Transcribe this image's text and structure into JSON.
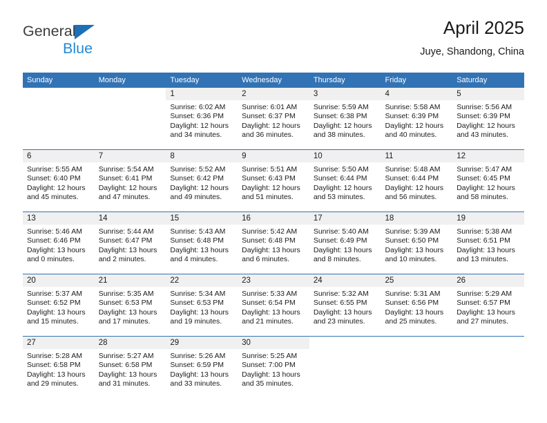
{
  "brand": {
    "name_top": "General",
    "name_bottom": "Blue",
    "accent_color": "#1e6fb8",
    "blue_text_color": "#2389d6"
  },
  "header": {
    "title": "April 2025",
    "subtitle": "Juye, Shandong, China"
  },
  "theme": {
    "header_blue": "#3273b5",
    "daynum_band": "#f0f0f0",
    "text": "#1a1a1a"
  },
  "weekday_headers": [
    "Sunday",
    "Monday",
    "Tuesday",
    "Wednesday",
    "Thursday",
    "Friday",
    "Saturday"
  ],
  "weeks": [
    [
      {
        "day": "",
        "sunrise": "",
        "sunset": "",
        "daylight_line1": "",
        "daylight_line2": "",
        "filled": false
      },
      {
        "day": "",
        "sunrise": "",
        "sunset": "",
        "daylight_line1": "",
        "daylight_line2": "",
        "filled": false
      },
      {
        "day": "1",
        "sunrise": "Sunrise: 6:02 AM",
        "sunset": "Sunset: 6:36 PM",
        "daylight_line1": "Daylight: 12 hours",
        "daylight_line2": "and 34 minutes.",
        "filled": true
      },
      {
        "day": "2",
        "sunrise": "Sunrise: 6:01 AM",
        "sunset": "Sunset: 6:37 PM",
        "daylight_line1": "Daylight: 12 hours",
        "daylight_line2": "and 36 minutes.",
        "filled": true
      },
      {
        "day": "3",
        "sunrise": "Sunrise: 5:59 AM",
        "sunset": "Sunset: 6:38 PM",
        "daylight_line1": "Daylight: 12 hours",
        "daylight_line2": "and 38 minutes.",
        "filled": true
      },
      {
        "day": "4",
        "sunrise": "Sunrise: 5:58 AM",
        "sunset": "Sunset: 6:39 PM",
        "daylight_line1": "Daylight: 12 hours",
        "daylight_line2": "and 40 minutes.",
        "filled": true
      },
      {
        "day": "5",
        "sunrise": "Sunrise: 5:56 AM",
        "sunset": "Sunset: 6:39 PM",
        "daylight_line1": "Daylight: 12 hours",
        "daylight_line2": "and 43 minutes.",
        "filled": true
      }
    ],
    [
      {
        "day": "6",
        "sunrise": "Sunrise: 5:55 AM",
        "sunset": "Sunset: 6:40 PM",
        "daylight_line1": "Daylight: 12 hours",
        "daylight_line2": "and 45 minutes.",
        "filled": true
      },
      {
        "day": "7",
        "sunrise": "Sunrise: 5:54 AM",
        "sunset": "Sunset: 6:41 PM",
        "daylight_line1": "Daylight: 12 hours",
        "daylight_line2": "and 47 minutes.",
        "filled": true
      },
      {
        "day": "8",
        "sunrise": "Sunrise: 5:52 AM",
        "sunset": "Sunset: 6:42 PM",
        "daylight_line1": "Daylight: 12 hours",
        "daylight_line2": "and 49 minutes.",
        "filled": true
      },
      {
        "day": "9",
        "sunrise": "Sunrise: 5:51 AM",
        "sunset": "Sunset: 6:43 PM",
        "daylight_line1": "Daylight: 12 hours",
        "daylight_line2": "and 51 minutes.",
        "filled": true
      },
      {
        "day": "10",
        "sunrise": "Sunrise: 5:50 AM",
        "sunset": "Sunset: 6:44 PM",
        "daylight_line1": "Daylight: 12 hours",
        "daylight_line2": "and 53 minutes.",
        "filled": true
      },
      {
        "day": "11",
        "sunrise": "Sunrise: 5:48 AM",
        "sunset": "Sunset: 6:44 PM",
        "daylight_line1": "Daylight: 12 hours",
        "daylight_line2": "and 56 minutes.",
        "filled": true
      },
      {
        "day": "12",
        "sunrise": "Sunrise: 5:47 AM",
        "sunset": "Sunset: 6:45 PM",
        "daylight_line1": "Daylight: 12 hours",
        "daylight_line2": "and 58 minutes.",
        "filled": true
      }
    ],
    [
      {
        "day": "13",
        "sunrise": "Sunrise: 5:46 AM",
        "sunset": "Sunset: 6:46 PM",
        "daylight_line1": "Daylight: 13 hours",
        "daylight_line2": "and 0 minutes.",
        "filled": true
      },
      {
        "day": "14",
        "sunrise": "Sunrise: 5:44 AM",
        "sunset": "Sunset: 6:47 PM",
        "daylight_line1": "Daylight: 13 hours",
        "daylight_line2": "and 2 minutes.",
        "filled": true
      },
      {
        "day": "15",
        "sunrise": "Sunrise: 5:43 AM",
        "sunset": "Sunset: 6:48 PM",
        "daylight_line1": "Daylight: 13 hours",
        "daylight_line2": "and 4 minutes.",
        "filled": true
      },
      {
        "day": "16",
        "sunrise": "Sunrise: 5:42 AM",
        "sunset": "Sunset: 6:48 PM",
        "daylight_line1": "Daylight: 13 hours",
        "daylight_line2": "and 6 minutes.",
        "filled": true
      },
      {
        "day": "17",
        "sunrise": "Sunrise: 5:40 AM",
        "sunset": "Sunset: 6:49 PM",
        "daylight_line1": "Daylight: 13 hours",
        "daylight_line2": "and 8 minutes.",
        "filled": true
      },
      {
        "day": "18",
        "sunrise": "Sunrise: 5:39 AM",
        "sunset": "Sunset: 6:50 PM",
        "daylight_line1": "Daylight: 13 hours",
        "daylight_line2": "and 10 minutes.",
        "filled": true
      },
      {
        "day": "19",
        "sunrise": "Sunrise: 5:38 AM",
        "sunset": "Sunset: 6:51 PM",
        "daylight_line1": "Daylight: 13 hours",
        "daylight_line2": "and 13 minutes.",
        "filled": true
      }
    ],
    [
      {
        "day": "20",
        "sunrise": "Sunrise: 5:37 AM",
        "sunset": "Sunset: 6:52 PM",
        "daylight_line1": "Daylight: 13 hours",
        "daylight_line2": "and 15 minutes.",
        "filled": true
      },
      {
        "day": "21",
        "sunrise": "Sunrise: 5:35 AM",
        "sunset": "Sunset: 6:53 PM",
        "daylight_line1": "Daylight: 13 hours",
        "daylight_line2": "and 17 minutes.",
        "filled": true
      },
      {
        "day": "22",
        "sunrise": "Sunrise: 5:34 AM",
        "sunset": "Sunset: 6:53 PM",
        "daylight_line1": "Daylight: 13 hours",
        "daylight_line2": "and 19 minutes.",
        "filled": true
      },
      {
        "day": "23",
        "sunrise": "Sunrise: 5:33 AM",
        "sunset": "Sunset: 6:54 PM",
        "daylight_line1": "Daylight: 13 hours",
        "daylight_line2": "and 21 minutes.",
        "filled": true
      },
      {
        "day": "24",
        "sunrise": "Sunrise: 5:32 AM",
        "sunset": "Sunset: 6:55 PM",
        "daylight_line1": "Daylight: 13 hours",
        "daylight_line2": "and 23 minutes.",
        "filled": true
      },
      {
        "day": "25",
        "sunrise": "Sunrise: 5:31 AM",
        "sunset": "Sunset: 6:56 PM",
        "daylight_line1": "Daylight: 13 hours",
        "daylight_line2": "and 25 minutes.",
        "filled": true
      },
      {
        "day": "26",
        "sunrise": "Sunrise: 5:29 AM",
        "sunset": "Sunset: 6:57 PM",
        "daylight_line1": "Daylight: 13 hours",
        "daylight_line2": "and 27 minutes.",
        "filled": true
      }
    ],
    [
      {
        "day": "27",
        "sunrise": "Sunrise: 5:28 AM",
        "sunset": "Sunset: 6:58 PM",
        "daylight_line1": "Daylight: 13 hours",
        "daylight_line2": "and 29 minutes.",
        "filled": true
      },
      {
        "day": "28",
        "sunrise": "Sunrise: 5:27 AM",
        "sunset": "Sunset: 6:58 PM",
        "daylight_line1": "Daylight: 13 hours",
        "daylight_line2": "and 31 minutes.",
        "filled": true
      },
      {
        "day": "29",
        "sunrise": "Sunrise: 5:26 AM",
        "sunset": "Sunset: 6:59 PM",
        "daylight_line1": "Daylight: 13 hours",
        "daylight_line2": "and 33 minutes.",
        "filled": true
      },
      {
        "day": "30",
        "sunrise": "Sunrise: 5:25 AM",
        "sunset": "Sunset: 7:00 PM",
        "daylight_line1": "Daylight: 13 hours",
        "daylight_line2": "and 35 minutes.",
        "filled": true
      },
      {
        "day": "",
        "sunrise": "",
        "sunset": "",
        "daylight_line1": "",
        "daylight_line2": "",
        "filled": false
      },
      {
        "day": "",
        "sunrise": "",
        "sunset": "",
        "daylight_line1": "",
        "daylight_line2": "",
        "filled": false
      },
      {
        "day": "",
        "sunrise": "",
        "sunset": "",
        "daylight_line1": "",
        "daylight_line2": "",
        "filled": false
      }
    ]
  ]
}
